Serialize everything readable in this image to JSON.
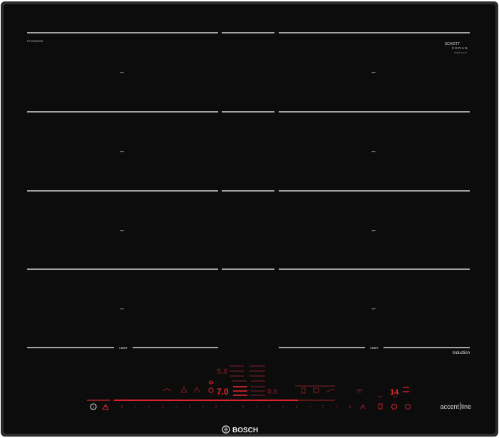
{
  "model_code": "PXY875DE3E",
  "glass_brand": {
    "line1": "SCHOTT",
    "line2": "CERAN",
    "line3": "CERAN-GLAS"
  },
  "zone_marker": "–",
  "flex_label": "ʟɪɴᴜᴛ",
  "induction_label": "Induction",
  "accent_word": "accent",
  "line_word": "line",
  "brand_name": "BOSCH",
  "display": {
    "power_level": "7.0",
    "timer_value": "14",
    "top_value": "5.8",
    "mid_value": "0.8"
  },
  "power_scale": [
    "0",
    "1",
    "2",
    "3",
    "4",
    "5",
    "6",
    "7",
    "8",
    "9"
  ],
  "colors": {
    "glass": "#0b0b0b",
    "frame": "#2b2b2b",
    "line": "#d8d8d8",
    "led_red": "#e0202a",
    "led_dim": "#6a1a1e"
  }
}
